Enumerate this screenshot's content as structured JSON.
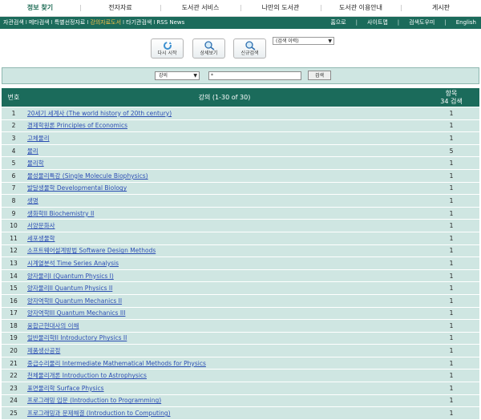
{
  "top_nav": [
    "정보 찾기",
    "전자자료",
    "도서관 서비스",
    "나만의 도서관",
    "도서관 이용안내",
    "게시판"
  ],
  "sub_nav": {
    "left": [
      "자관검색",
      "메타검색",
      "특별선정자료",
      "강의자료도서",
      "타기관검색",
      "RSS News"
    ],
    "right": [
      "홈으로",
      "사이트맵",
      "검색도우미",
      "English"
    ]
  },
  "toolbar": {
    "restart_label": "다시 시작",
    "detail_label": "상세보기",
    "new_search_label": "신규검색",
    "history_select": "(검색 이력)"
  },
  "search": {
    "field": "강의",
    "query": "*",
    "button": "검색"
  },
  "table": {
    "col_num": "번호",
    "col_title": "강의 (1-30 of 30)",
    "col_count_line1": "항목",
    "col_count_line2": "34 검색",
    "rows": [
      {
        "num": "1",
        "title": "20세기 세계사 (The world history of 20th century)",
        "count": "1"
      },
      {
        "num": "2",
        "title": "경제학원론 Principles of Economics",
        "count": "1"
      },
      {
        "num": "3",
        "title": "고체물리",
        "count": "1"
      },
      {
        "num": "4",
        "title": "물리",
        "count": "5"
      },
      {
        "num": "5",
        "title": "물리학",
        "count": "1"
      },
      {
        "num": "6",
        "title": "물성물리특강 (Single Molecule Biophysics)",
        "count": "1"
      },
      {
        "num": "7",
        "title": "발달생물학 Developmental Biology",
        "count": "1"
      },
      {
        "num": "8",
        "title": "생명",
        "count": "1"
      },
      {
        "num": "9",
        "title": "생화학II Biochemistry II",
        "count": "1"
      },
      {
        "num": "10",
        "title": "서양문화사",
        "count": "1"
      },
      {
        "num": "11",
        "title": "세포생물학",
        "count": "1"
      },
      {
        "num": "12",
        "title": "소프트웨어설계방법 Software Design Methods",
        "count": "1"
      },
      {
        "num": "13",
        "title": "시계열분석 Time Series Analysis",
        "count": "1"
      },
      {
        "num": "14",
        "title": "양자물리I (Quantum Physics I)",
        "count": "1"
      },
      {
        "num": "15",
        "title": "양자물리II Quantum Physics II",
        "count": "1"
      },
      {
        "num": "16",
        "title": "양자역학II Quantum Mechanics II",
        "count": "1"
      },
      {
        "num": "17",
        "title": "양자역학III Quantum Mechanics III",
        "count": "1"
      },
      {
        "num": "18",
        "title": "융합근현대사의 이해",
        "count": "1"
      },
      {
        "num": "19",
        "title": "일반물리학II Introductory Physics II",
        "count": "1"
      },
      {
        "num": "20",
        "title": "제품생산공정",
        "count": "1"
      },
      {
        "num": "21",
        "title": "중급수리물리 Intermediate Mathematical Methods for Physics",
        "count": "1"
      },
      {
        "num": "22",
        "title": "천체물리개론 Introduction to Astrophysics",
        "count": "1"
      },
      {
        "num": "23",
        "title": "표면물리학 Surface Physics",
        "count": "1"
      },
      {
        "num": "24",
        "title": "프로그래밍 입문 (Introduction to Programming)",
        "count": "1"
      },
      {
        "num": "25",
        "title": "프로그래밍과 문제해결 (Introduction to Computing)",
        "count": "1"
      }
    ]
  }
}
